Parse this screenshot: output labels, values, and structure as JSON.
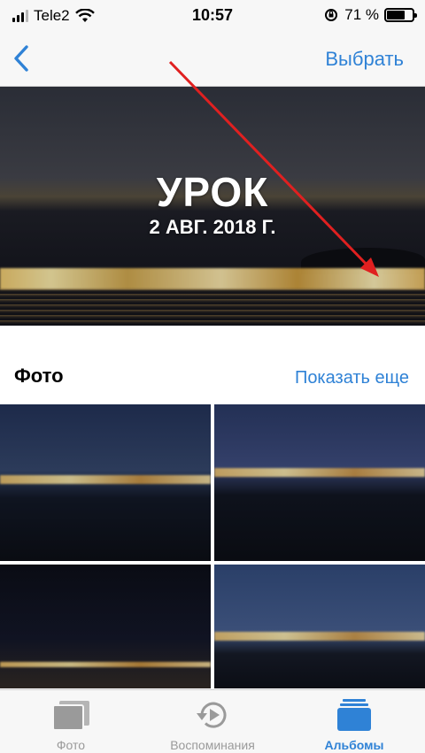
{
  "status_bar": {
    "carrier": "Tele2",
    "time": "10:57",
    "battery_percent": "71 %",
    "battery_level": 0.71
  },
  "nav": {
    "back_icon": "chevron-left-icon",
    "select_label": "Выбрать"
  },
  "hero": {
    "title": "УРОК",
    "date": "2 АВГ. 2018 Г.",
    "play_icon": "play-icon"
  },
  "photos_section": {
    "title": "Фото",
    "show_more": "Показать еще"
  },
  "tabbar": {
    "tabs": [
      {
        "label": "Фото",
        "icon": "photos-icon",
        "active": false
      },
      {
        "label": "Воспоминания",
        "icon": "memories-icon",
        "active": false
      },
      {
        "label": "Альбомы",
        "icon": "albums-icon",
        "active": true
      }
    ]
  },
  "colors": {
    "accent": "#2f82d6",
    "annotation_arrow": "#e02020",
    "inactive_tab": "#9a9a9a"
  }
}
